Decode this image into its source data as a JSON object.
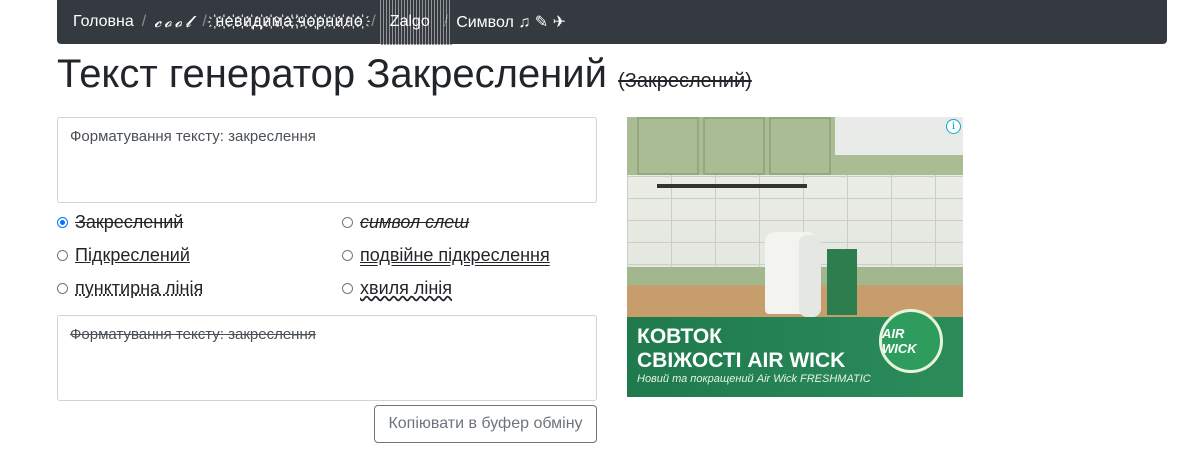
{
  "nav": {
    "home": "Головна",
    "cool": "𝓬𝓸𝓸𝓵",
    "invisible_ink": "҉н҉е҉в҉и҉д҉и҉м҉а҉ ҉ч҉о҉р҉н҉и҉л҉о҉",
    "zalgo": "Zalgo",
    "symbol": "Символ ♫ ✎ ✈",
    "separator": "/"
  },
  "page": {
    "title": "Текст генератор Закреслений",
    "subtitle": "(Закреслений)"
  },
  "input": {
    "value": "Форматування тексту: закреслення"
  },
  "options": [
    {
      "label": "Закреслений",
      "checked": true
    },
    {
      "label": "символ слеш",
      "checked": false
    },
    {
      "label": "Підкреслений",
      "checked": false
    },
    {
      "label": "подвійне підкреслення",
      "checked": false
    },
    {
      "label": "пунктирна лінія",
      "checked": false
    },
    {
      "label": "хвиля лінія",
      "checked": false
    }
  ],
  "output": {
    "value": "Форматування тексту: закреслення"
  },
  "copy_button": "Копіювати в буфер обміну",
  "ad": {
    "headline_1": "КОВТОК",
    "headline_2": "СВІЖОСТІ AIR WICK",
    "tagline": "Новий та покращений Air Wick FRESHMATIC",
    "logo_text": "AIR WICK",
    "info_icon": "info-icon"
  }
}
